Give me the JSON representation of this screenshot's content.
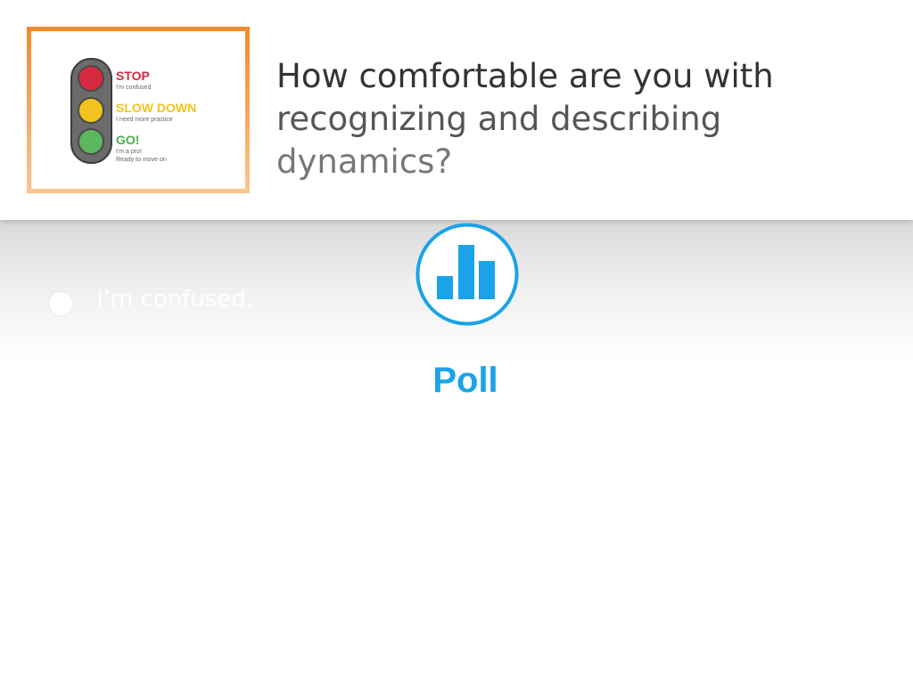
{
  "question": {
    "lines": [
      "How comfortable are you with",
      "recognizing and describing",
      "dynamics?"
    ]
  },
  "thumbnail": {
    "stop": {
      "title": "STOP",
      "subtitle": "I'm confused",
      "color": "#d8283f"
    },
    "slow": {
      "title": "SLOW DOWN",
      "subtitle": "I need more practice",
      "color": "#f4c21d"
    },
    "go": {
      "title": "GO!",
      "subtitle_line1": "I'm a pro!",
      "subtitle_line2": "Ready to move on",
      "color": "#4caf50"
    },
    "icon": "traffic-light-icon"
  },
  "options": [
    {
      "label": "I’m confused."
    }
  ],
  "poll": {
    "label": "Poll",
    "icon": "bar-chart-icon",
    "color": "#1aa3e8"
  }
}
